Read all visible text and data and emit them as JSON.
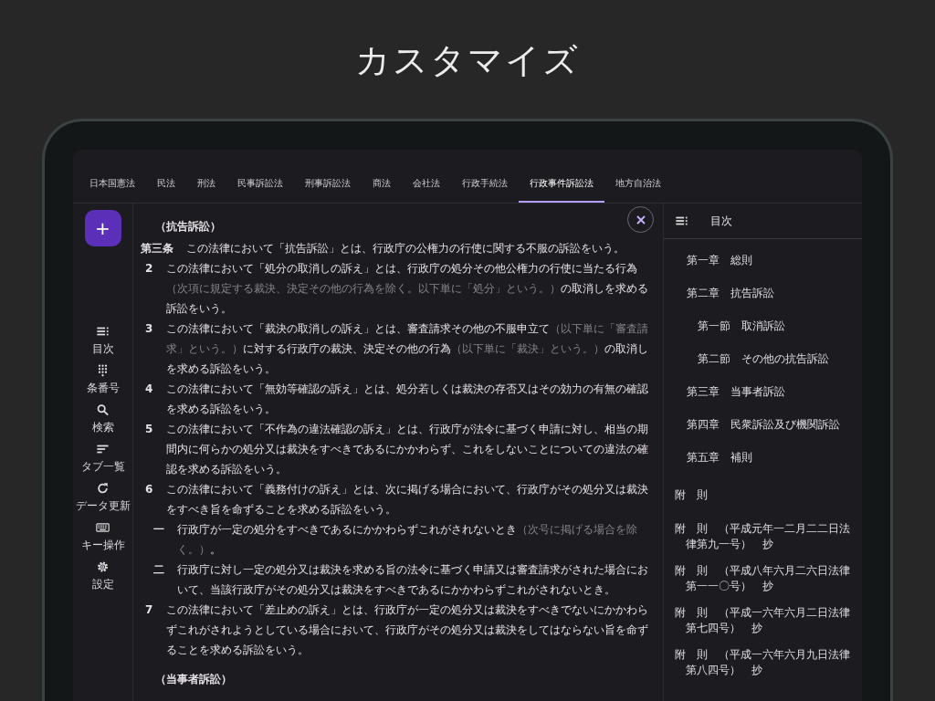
{
  "title": "カスタマイズ",
  "tabs": [
    {
      "label": "日本国憲法",
      "selected": false
    },
    {
      "label": "民法",
      "selected": false
    },
    {
      "label": "刑法",
      "selected": false
    },
    {
      "label": "民事訴訟法",
      "selected": false
    },
    {
      "label": "刑事訴訟法",
      "selected": false
    },
    {
      "label": "商法",
      "selected": false
    },
    {
      "label": "会社法",
      "selected": false
    },
    {
      "label": "行政手続法",
      "selected": false
    },
    {
      "label": "行政事件訴訟法",
      "selected": true
    },
    {
      "label": "地方自治法",
      "selected": false
    }
  ],
  "fab": {
    "label": "+"
  },
  "rail": [
    {
      "kind": "toc",
      "label": "目次"
    },
    {
      "kind": "numbers",
      "label": "条番号"
    },
    {
      "kind": "search",
      "label": "検索"
    },
    {
      "kind": "tabs",
      "label": "タブ一覧"
    },
    {
      "kind": "refresh",
      "label": "データ更新"
    },
    {
      "kind": "keyboard",
      "label": "キー操作"
    },
    {
      "kind": "settings",
      "label": "設定"
    }
  ],
  "article": [
    {
      "kind": "heading",
      "parts": [
        {
          "text": "（抗告訴訟）",
          "muted": false
        }
      ]
    },
    {
      "kind": "article",
      "num": "第三条",
      "parts": [
        {
          "text": "この法律において「抗告訴訟」とは、行政庁の公権力の行使に関する不服の訴訟をいう。",
          "muted": false
        }
      ]
    },
    {
      "kind": "paragraph",
      "num": "2",
      "parts": [
        {
          "text": "この法律において「処分の取消しの訴え」とは、行政庁の処分その他公権力の行使に当たる行為",
          "muted": false
        },
        {
          "text": "（次項に規定する裁決、決定その他の行為を除く。以下単に「処分」という。）",
          "muted": true
        },
        {
          "text": "の取消しを求める訴訟をいう。",
          "muted": false
        }
      ]
    },
    {
      "kind": "paragraph",
      "num": "3",
      "parts": [
        {
          "text": "この法律において「裁決の取消しの訴え」とは、審査請求その他の不服申立て",
          "muted": false
        },
        {
          "text": "（以下単に「審査請求」という。）",
          "muted": true
        },
        {
          "text": "に対する行政庁の裁決、決定その他の行為",
          "muted": false
        },
        {
          "text": "（以下単に「裁決」という。）",
          "muted": true
        },
        {
          "text": "の取消しを求める訴訟をいう。",
          "muted": false
        }
      ]
    },
    {
      "kind": "paragraph",
      "num": "4",
      "parts": [
        {
          "text": "この法律において「無効等確認の訴え」とは、処分若しくは裁決の存否又はその効力の有無の確認を求める訴訟をいう。",
          "muted": false
        }
      ]
    },
    {
      "kind": "paragraph",
      "num": "5",
      "parts": [
        {
          "text": "この法律において「不作為の違法確認の訴え」とは、行政庁が法令に基づく申請に対し、相当の期間内に何らかの処分又は裁決をすべきであるにかかわらず、これをしないことについての違法の確認を求める訴訟をいう。",
          "muted": false
        }
      ]
    },
    {
      "kind": "paragraph",
      "num": "6",
      "parts": [
        {
          "text": "この法律において「義務付けの訴え」とは、次に掲げる場合において、行政庁がその処分又は裁決をすべき旨を命ずることを求める訴訟をいう。",
          "muted": false
        }
      ]
    },
    {
      "kind": "item",
      "num": "一",
      "parts": [
        {
          "text": "行政庁が一定の処分をすべきであるにかかわらずこれがされないとき",
          "muted": false
        },
        {
          "text": "（次号に掲げる場合を除く。）",
          "muted": true
        },
        {
          "text": "。",
          "muted": false
        }
      ]
    },
    {
      "kind": "item",
      "num": "二",
      "parts": [
        {
          "text": "行政庁に対し一定の処分又は裁決を求める旨の法令に基づく申請又は審査請求がされた場合において、当該行政庁がその処分又は裁決をすべきであるにかかわらずこれがされないとき。",
          "muted": false
        }
      ]
    },
    {
      "kind": "paragraph",
      "num": "7",
      "parts": [
        {
          "text": "この法律において「差止めの訴え」とは、行政庁が一定の処分又は裁決をすべきでないにかかわらずこれがされようとしている場合において、行政庁がその処分又は裁決をしてはならない旨を命ずることを求める訴訟をいう。",
          "muted": false
        }
      ]
    },
    {
      "kind": "heading",
      "parts": [
        {
          "text": "（当事者訴訟）",
          "muted": false
        }
      ]
    }
  ],
  "toc": {
    "title": "目次",
    "chapters": [
      {
        "label": "第一章　総則"
      },
      {
        "label": "第二章　抗告訴訟",
        "children": [
          {
            "label": "第一節　取消訴訟"
          },
          {
            "label": "第二節　その他の抗告訴訟"
          }
        ]
      },
      {
        "label": "第三章　当事者訴訟"
      },
      {
        "label": "第四章　民衆訴訟及び機関訴訟"
      },
      {
        "label": "第五章　補則"
      }
    ],
    "supplementary": [
      "附　則",
      "附　則　（平成元年一二月二二日法律第九一号）　抄",
      "附　則　（平成八年六月二六日法律第一一〇号）　抄",
      "附　則　（平成一六年六月二日法律第七四号）　抄",
      "附　則　（平成一六年六月九日法律第八四号）　抄"
    ]
  }
}
